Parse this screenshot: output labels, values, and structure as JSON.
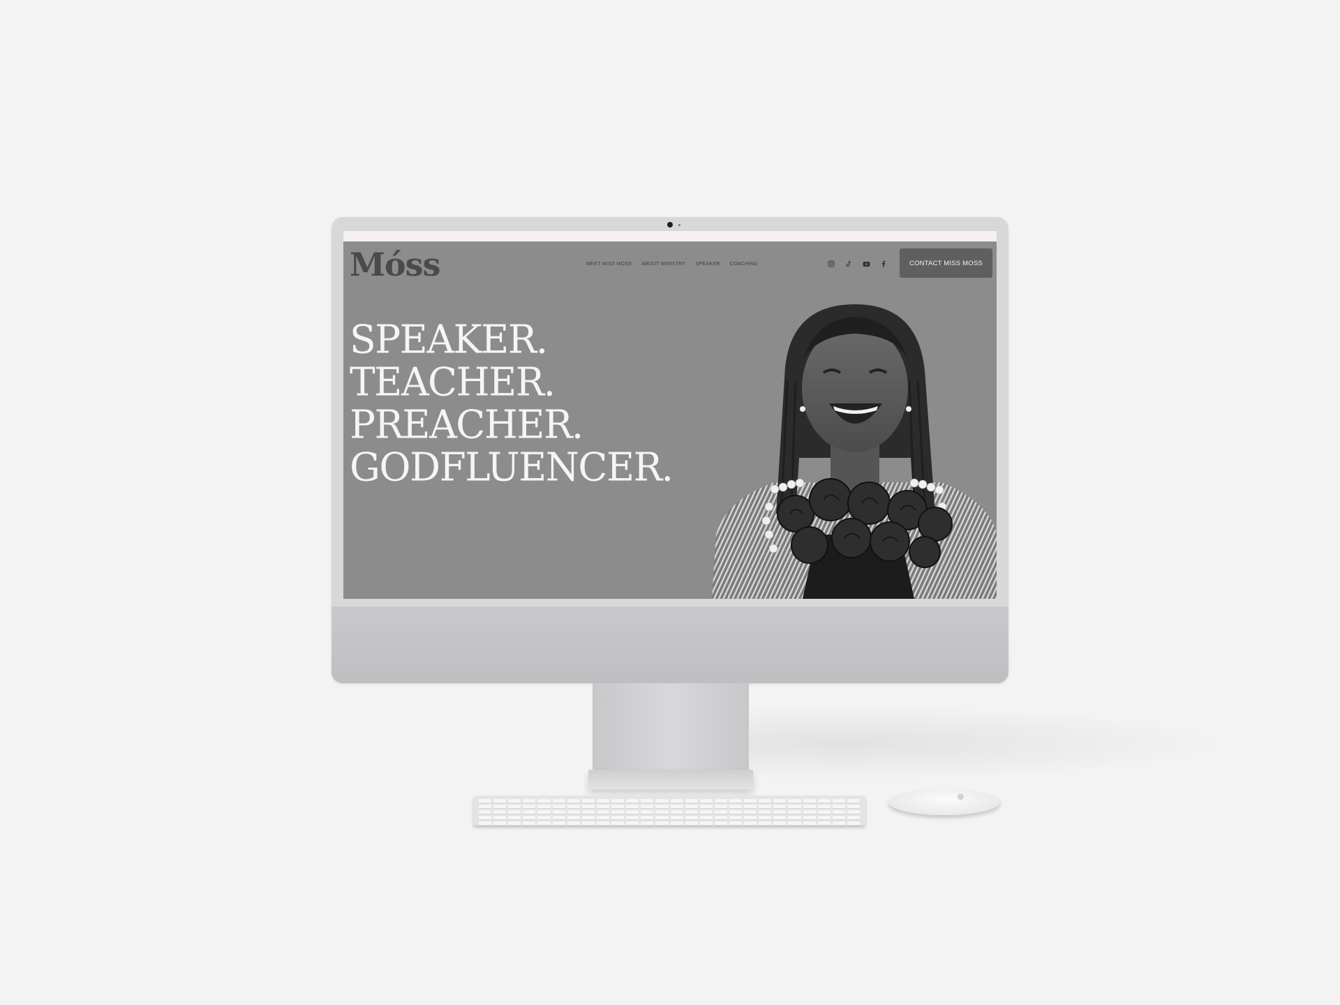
{
  "site": {
    "logo": "Móss",
    "nav": {
      "items": [
        {
          "label": "MEET MISS MOSS"
        },
        {
          "label": "ABOUT MINISTRY"
        },
        {
          "label": "SPEAKER"
        },
        {
          "label": "COACHING"
        }
      ]
    },
    "socials": [
      {
        "icon": "instagram-icon"
      },
      {
        "icon": "tiktok-icon"
      },
      {
        "icon": "youtube-icon"
      },
      {
        "icon": "facebook-icon"
      }
    ],
    "cta_label": "CONTACT MISS MOSS"
  },
  "hero": {
    "lines": [
      "SPEAKER.",
      "TEACHER.",
      "PREACHER.",
      "GODFLUENCER."
    ]
  },
  "colors": {
    "hero_background": "#8c8c8c",
    "cta_background": "#5f5f5f",
    "headline": "#f5f5f5",
    "logo": "#4a4a4a"
  }
}
